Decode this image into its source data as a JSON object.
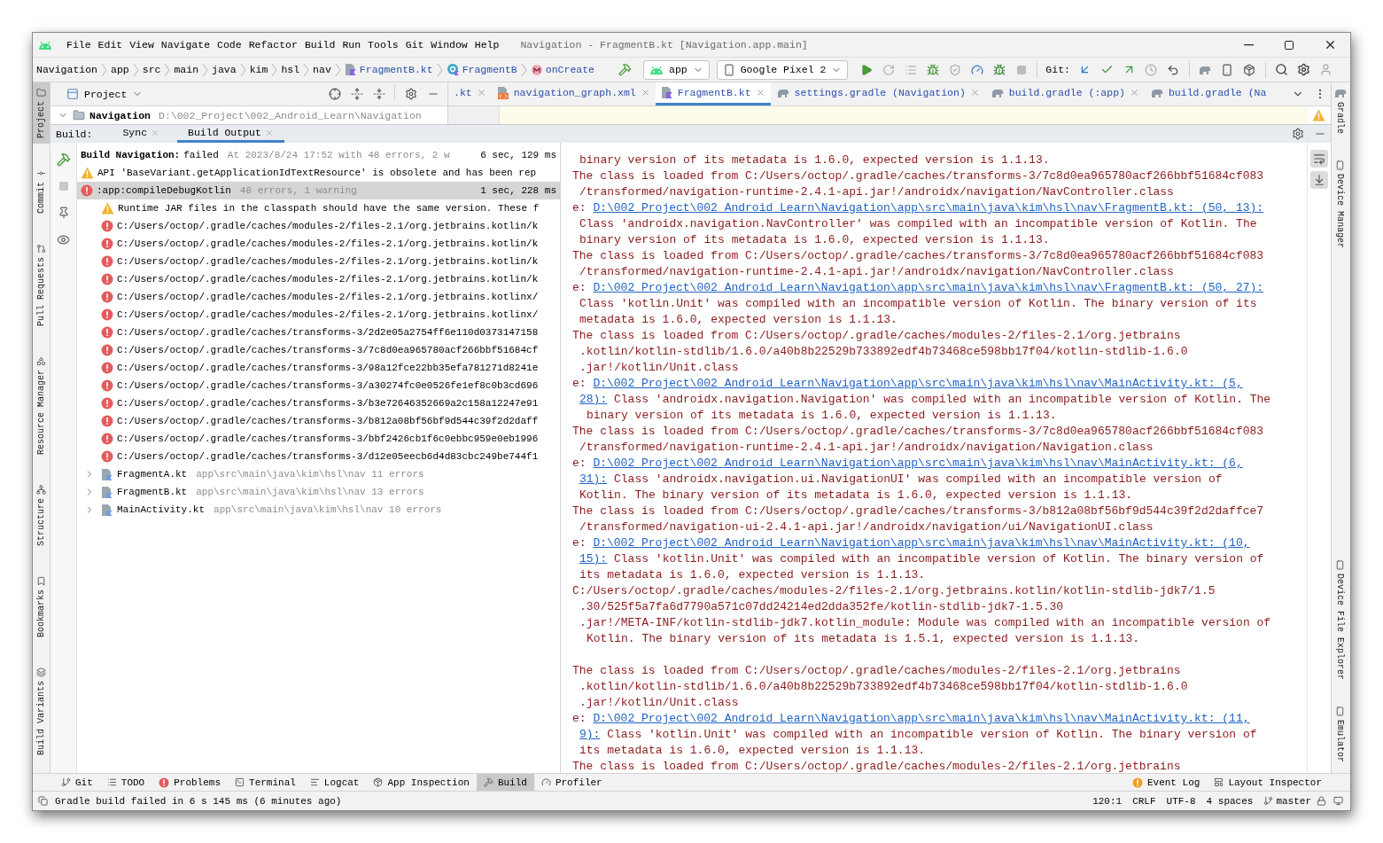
{
  "window": {
    "title": "Navigation - FragmentB.kt [Navigation.app.main]"
  },
  "menu": [
    "File",
    "Edit",
    "View",
    "Navigate",
    "Code",
    "Refactor",
    "Build",
    "Run",
    "Tools",
    "Git",
    "Window",
    "Help"
  ],
  "breadcrumbs": [
    {
      "label": "Navigation",
      "kind": "folder"
    },
    {
      "label": "app",
      "kind": "folder"
    },
    {
      "label": "src",
      "kind": "folder"
    },
    {
      "label": "main",
      "kind": "folder"
    },
    {
      "label": "java",
      "kind": "folder"
    },
    {
      "label": "kim",
      "kind": "folder"
    },
    {
      "label": "hsl",
      "kind": "folder"
    },
    {
      "label": "nav",
      "kind": "folder"
    },
    {
      "label": "FragmentB.kt",
      "kind": "file"
    },
    {
      "label": "FragmentB",
      "kind": "class"
    },
    {
      "label": "onCreate",
      "kind": "method"
    }
  ],
  "run_config": "app",
  "device": "Google Pixel 2",
  "git_label": "Git:",
  "project_panel": {
    "title": "Project",
    "root": {
      "name": "Navigation",
      "path": "D:\\002_Project\\002_Android_Learn\\Navigation"
    }
  },
  "editor_tabs": [
    {
      "label": ".kt",
      "kind": "cut",
      "selected": false,
      "closable": true
    },
    {
      "label": "navigation_graph.xml",
      "kind": "xml",
      "selected": false,
      "closable": true
    },
    {
      "label": "FragmentB.kt",
      "kind": "kotlin",
      "selected": true,
      "closable": true
    },
    {
      "label": "settings.gradle (Navigation)",
      "kind": "gradle",
      "selected": false,
      "closable": true
    },
    {
      "label": "build.gradle (:app)",
      "kind": "gradle",
      "selected": false,
      "closable": true
    },
    {
      "label": "build.gradle (Na",
      "kind": "gradle",
      "selected": false,
      "closable": false
    }
  ],
  "tool_windows_left": [
    {
      "label": "Project",
      "selected": true
    },
    {
      "label": "Commit",
      "selected": false
    },
    {
      "label": "Pull Requests",
      "selected": false
    },
    {
      "label": "Resource Manager",
      "selected": false
    },
    {
      "label": "Structure",
      "selected": false
    },
    {
      "label": "Bookmarks",
      "selected": false
    },
    {
      "label": "Build Variants",
      "selected": false
    }
  ],
  "tool_windows_right": {
    "top": [
      {
        "label": "Gradle",
        "selected": false
      },
      {
        "label": "Device Manager",
        "selected": false
      }
    ],
    "bottom": [
      {
        "label": "Device File Explorer",
        "selected": false
      },
      {
        "label": "Emulator",
        "selected": false
      }
    ]
  },
  "build_panel": {
    "label": "Build:",
    "tabs": [
      {
        "label": "Sync",
        "selected": false
      },
      {
        "label": "Build Output",
        "selected": true
      }
    ],
    "tree": [
      {
        "kind": "build",
        "label": "Build Navigation:",
        "status": "failed",
        "detail": "At 2023/8/24 17:52 with 48 errors, 2 w",
        "time": "6 sec, 129 ms",
        "selected": false,
        "children": [
          {
            "kind": "warning",
            "label": "API 'BaseVariant.getApplicationIdTextResource' is obsolete and has been rep",
            "selected": false
          },
          {
            "kind": "task",
            "label": ":app:compileDebugKotlin",
            "detail": "48 errors, 1 warning",
            "time": "1 sec, 228 ms",
            "selected": true,
            "children": [
              {
                "kind": "warning",
                "label": "Runtime JAR files in the classpath should have the same version. These f",
                "selected": false
              },
              {
                "kind": "error",
                "label": "C:/Users/octop/.gradle/caches/modules-2/files-2.1/org.jetbrains.kotlin/k",
                "selected": false
              },
              {
                "kind": "error",
                "label": "C:/Users/octop/.gradle/caches/modules-2/files-2.1/org.jetbrains.kotlin/k",
                "selected": false
              },
              {
                "kind": "error",
                "label": "C:/Users/octop/.gradle/caches/modules-2/files-2.1/org.jetbrains.kotlin/k",
                "selected": false
              },
              {
                "kind": "error",
                "label": "C:/Users/octop/.gradle/caches/modules-2/files-2.1/org.jetbrains.kotlin/k",
                "selected": false
              },
              {
                "kind": "error",
                "label": "C:/Users/octop/.gradle/caches/modules-2/files-2.1/org.jetbrains.kotlinx/",
                "selected": false
              },
              {
                "kind": "error",
                "label": "C:/Users/octop/.gradle/caches/modules-2/files-2.1/org.jetbrains.kotlinx/",
                "selected": false
              },
              {
                "kind": "error",
                "label": "C:/Users/octop/.gradle/caches/transforms-3/2d2e05a2754ff6e110d0373147158",
                "selected": false
              },
              {
                "kind": "error",
                "label": "C:/Users/octop/.gradle/caches/transforms-3/7c8d0ea965780acf266bbf51684cf",
                "selected": false
              },
              {
                "kind": "error",
                "label": "C:/Users/octop/.gradle/caches/transforms-3/98a12fce22bb35efa781271d8241e",
                "selected": false
              },
              {
                "kind": "error",
                "label": "C:/Users/octop/.gradle/caches/transforms-3/a30274fc0e0526fe1ef8c0b3cd696",
                "selected": false
              },
              {
                "kind": "error",
                "label": "C:/Users/octop/.gradle/caches/transforms-3/b3e72646352669a2c158a12247e91",
                "selected": false
              },
              {
                "kind": "error",
                "label": "C:/Users/octop/.gradle/caches/transforms-3/b812a08bf56bf9d544c39f2d2daff",
                "selected": false
              },
              {
                "kind": "error",
                "label": "C:/Users/octop/.gradle/caches/transforms-3/bbf2426cb1f6c0ebbc959e0eb1996",
                "selected": false
              },
              {
                "kind": "error",
                "label": "C:/Users/octop/.gradle/caches/transforms-3/d12e05eecb6d4d83cbc249be744f1",
                "selected": false
              },
              {
                "kind": "file",
                "label": "FragmentA.kt",
                "detail": "app\\src\\main\\java\\kim\\hsl\\nav 11 errors",
                "selected": false,
                "expanded": false
              },
              {
                "kind": "file",
                "label": "FragmentB.kt",
                "detail": "app\\src\\main\\java\\kim\\hsl\\nav 13 errors",
                "selected": false,
                "expanded": false
              },
              {
                "kind": "file",
                "label": "MainActivity.kt",
                "detail": "app\\src\\main\\java\\kim\\hsl\\nav 10 errors",
                "selected": false,
                "expanded": false
              }
            ]
          }
        ]
      }
    ],
    "output": [
      {
        "kind": "cont",
        "text": "binary version of its metadata is 1.6.0, expected version is 1.1.13."
      },
      {
        "kind": "head",
        "text": "The class is loaded from C:/Users/octop/.gradle/caches/transforms-3/7c8d0ea965780acf266bbf51684cf083"
      },
      {
        "kind": "cont",
        "text": "/transformed/navigation-runtime-2.4.1-api.jar!/androidx/navigation/NavController.class"
      },
      {
        "kind": "head",
        "parts": [
          {
            "text": "e: "
          },
          {
            "text": "D:\\002_Project\\002_Android_Learn\\Navigation\\app\\src\\main\\java\\kim\\hsl\\nav\\FragmentB.kt: (50, 13):",
            "link": true
          }
        ]
      },
      {
        "kind": "cont",
        "text": "Class 'androidx.navigation.NavController' was compiled with an incompatible version of Kotlin. The"
      },
      {
        "kind": "cont",
        "text": "binary version of its metadata is 1.6.0, expected version is 1.1.13."
      },
      {
        "kind": "head",
        "text": "The class is loaded from C:/Users/octop/.gradle/caches/transforms-3/7c8d0ea965780acf266bbf51684cf083"
      },
      {
        "kind": "cont",
        "text": "/transformed/navigation-runtime-2.4.1-api.jar!/androidx/navigation/NavController.class"
      },
      {
        "kind": "head",
        "parts": [
          {
            "text": "e: "
          },
          {
            "text": "D:\\002_Project\\002_Android_Learn\\Navigation\\app\\src\\main\\java\\kim\\hsl\\nav\\FragmentB.kt: (50, 27):",
            "link": true
          }
        ]
      },
      {
        "kind": "cont",
        "text": "Class 'kotlin.Unit' was compiled with an incompatible version of Kotlin. The binary version of its"
      },
      {
        "kind": "cont",
        "text": "metadata is 1.6.0, expected version is 1.1.13."
      },
      {
        "kind": "head",
        "text": "The class is loaded from C:/Users/octop/.gradle/caches/modules-2/files-2.1/org.jetbrains"
      },
      {
        "kind": "cont",
        "text": ".kotlin/kotlin-stdlib/1.6.0/a40b8b22529b733892edf4b73468ce598bb17f04/kotlin-stdlib-1.6.0"
      },
      {
        "kind": "cont",
        "text": ".jar!/kotlin/Unit.class"
      },
      {
        "kind": "head",
        "parts": [
          {
            "text": "e: "
          },
          {
            "text": "D:\\002_Project\\002_Android_Learn\\Navigation\\app\\src\\main\\java\\kim\\hsl\\nav\\MainActivity.kt: (5,",
            "link": true
          }
        ]
      },
      {
        "kind": "cont",
        "parts": [
          {
            "text": "28):",
            "link": true
          },
          {
            "text": " Class 'androidx.navigation.Navigation' was compiled with an incompatible version of Kotlin. The"
          }
        ]
      },
      {
        "kind": "cont2",
        "text": "binary version of its metadata is 1.6.0, expected version is 1.1.13."
      },
      {
        "kind": "head",
        "text": "The class is loaded from C:/Users/octop/.gradle/caches/transforms-3/7c8d0ea965780acf266bbf51684cf083"
      },
      {
        "kind": "cont",
        "text": "/transformed/navigation-runtime-2.4.1-api.jar!/androidx/navigation/Navigation.class"
      },
      {
        "kind": "head",
        "parts": [
          {
            "text": "e: "
          },
          {
            "text": "D:\\002_Project\\002_Android_Learn\\Navigation\\app\\src\\main\\java\\kim\\hsl\\nav\\MainActivity.kt: (6,",
            "link": true
          }
        ]
      },
      {
        "kind": "cont",
        "parts": [
          {
            "text": "31):",
            "link": true
          },
          {
            "text": " Class 'androidx.navigation.ui.NavigationUI' was compiled with an incompatible version of"
          }
        ]
      },
      {
        "kind": "cont",
        "text": "Kotlin. The binary version of its metadata is 1.6.0, expected version is 1.1.13."
      },
      {
        "kind": "head",
        "text": "The class is loaded from C:/Users/octop/.gradle/caches/transforms-3/b812a08bf56bf9d544c39f2d2daffce7"
      },
      {
        "kind": "cont",
        "text": "/transformed/navigation-ui-2.4.1-api.jar!/androidx/navigation/ui/NavigationUI.class"
      },
      {
        "kind": "head",
        "parts": [
          {
            "text": "e: "
          },
          {
            "text": "D:\\002_Project\\002_Android_Learn\\Navigation\\app\\src\\main\\java\\kim\\hsl\\nav\\MainActivity.kt: (10,",
            "link": true
          }
        ]
      },
      {
        "kind": "cont",
        "parts": [
          {
            "text": "15):",
            "link": true
          },
          {
            "text": " Class 'kotlin.Unit' was compiled with an incompatible version of Kotlin. The binary version of"
          }
        ]
      },
      {
        "kind": "cont",
        "text": "its metadata is 1.6.0, expected version is 1.1.13."
      },
      {
        "kind": "head",
        "text": "C:/Users/octop/.gradle/caches/modules-2/files-2.1/org.jetbrains.kotlin/kotlin-stdlib-jdk7/1.5"
      },
      {
        "kind": "cont",
        "text": ".30/525f5a7fa6d7790a571c07dd24214ed2dda352fe/kotlin-stdlib-jdk7-1.5.30"
      },
      {
        "kind": "cont",
        "text": ".jar!/META-INF/kotlin-stdlib-jdk7.kotlin_module: Module was compiled with an incompatible version of"
      },
      {
        "kind": "cont2",
        "text": "Kotlin. The binary version of its metadata is 1.5.1, expected version is 1.1.13."
      },
      {
        "kind": "blank"
      },
      {
        "kind": "head",
        "text": "The class is loaded from C:/Users/octop/.gradle/caches/modules-2/files-2.1/org.jetbrains"
      },
      {
        "kind": "cont",
        "text": ".kotlin/kotlin-stdlib/1.6.0/a40b8b22529b733892edf4b73468ce598bb17f04/kotlin-stdlib-1.6.0"
      },
      {
        "kind": "cont",
        "text": ".jar!/kotlin/Unit.class"
      },
      {
        "kind": "head",
        "parts": [
          {
            "text": "e: "
          },
          {
            "text": "D:\\002_Project\\002_Android_Learn\\Navigation\\app\\src\\main\\java\\kim\\hsl\\nav\\MainActivity.kt: (11,",
            "link": true
          }
        ]
      },
      {
        "kind": "cont",
        "parts": [
          {
            "text": "9):",
            "link": true
          },
          {
            "text": " Class 'kotlin.Unit' was compiled with an incompatible version of Kotlin. The binary version of"
          }
        ]
      },
      {
        "kind": "cont",
        "text": "its metadata is 1.6.0, expected version is 1.1.13."
      },
      {
        "kind": "head",
        "text": "The class is loaded from C:/Users/octop/.gradle/caches/modules-2/files-2.1/org.jetbrains"
      }
    ]
  },
  "bottom_tabs": [
    {
      "label": "Git",
      "selected": false
    },
    {
      "label": "TODO",
      "selected": false
    },
    {
      "label": "Problems",
      "selected": false
    },
    {
      "label": "Terminal",
      "selected": false
    },
    {
      "label": "Logcat",
      "selected": false
    },
    {
      "label": "App Inspection",
      "selected": false
    },
    {
      "label": "Build",
      "selected": true
    },
    {
      "label": "Profiler",
      "selected": false
    }
  ],
  "bottom_tabs_right": [
    {
      "label": "Event Log",
      "selected": false
    },
    {
      "label": "Layout Inspector",
      "selected": false
    }
  ],
  "status": {
    "message": "Gradle build failed in 6 s 145 ms (6 minutes ago)",
    "position": "120:1",
    "line_separator": "CRLF",
    "encoding": "UTF-8",
    "indent": "4 spaces",
    "branch": "master"
  }
}
